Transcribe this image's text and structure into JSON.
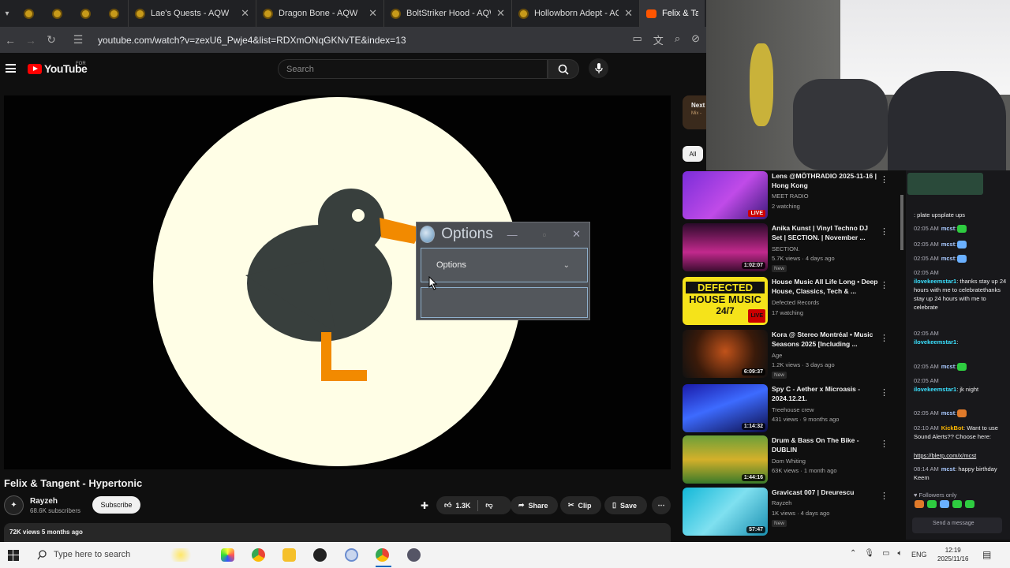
{
  "browser": {
    "tabs": [
      {
        "title": "Lae's Quests - AQW"
      },
      {
        "title": "Dragon Bone - AQW"
      },
      {
        "title": "BoltStriker Hood - AQW"
      },
      {
        "title": "Hollowborn Adept - AQW"
      },
      {
        "title": "Felix & Tange"
      }
    ],
    "url": "youtube.com/watch?v=zexU6_Pwje4&list=RDXmONqGKNvTE&index=13"
  },
  "youtube": {
    "logo_text": "YouTube",
    "logo_sup": "FOR",
    "search_placeholder": "Search",
    "video_title": "Felix & Tangent - Hypertonic",
    "channel_name": "Rayzeh",
    "subscribers": "68.6K subscribers",
    "subscribe_label": "Subscribe",
    "likes": "1.3K",
    "share_label": "Share",
    "clip_label": "Clip",
    "save_label": "Save",
    "desc_meta": "72K views  5 months ago",
    "next_label": "Next",
    "next_sub": "Mix -",
    "chip_all": "All"
  },
  "options_window": {
    "title": "Options",
    "select_value": "Options"
  },
  "recommendations": [
    {
      "title": "Lens @MÖTHRADIO 2025-11-16 | Hong Kong",
      "channel": "MEET RADIO",
      "meta": "2 watching",
      "badge": "LIVE",
      "new": ""
    },
    {
      "title": "Anika Kunst | Vinyl Techno DJ Set | SECTION. | November ...",
      "channel": "SECTION.",
      "meta": "5.7K views · 4 days ago",
      "badge": "1:02:07",
      "new": "New"
    },
    {
      "title": "House Music All Life Long • Deep House, Classics, Tech & ...",
      "channel": "Defected Records",
      "meta": "17 watching",
      "badge": "LIVE",
      "new": ""
    },
    {
      "title": "Kora @ Stereo Montréal • Music Seasons 2025 [Including ...",
      "channel": "Age",
      "meta": "1.2K views · 3 days ago",
      "badge": "6:09:37",
      "new": "New"
    },
    {
      "title": "Spy C - Aether x Microasis - 2024.12.21.",
      "channel": "Treehouse crew",
      "meta": "431 views · 9 months ago",
      "badge": "1:14:32",
      "new": ""
    },
    {
      "title": "Drum & Bass On The Bike - DUBLIN",
      "channel": "Dom Whiting",
      "meta": "63K views · 1 month ago",
      "badge": "1:44:16",
      "new": ""
    },
    {
      "title": "Gravicast 007 | Dreurescu",
      "channel": "Rayzeh",
      "meta": "1K views · 4 days ago",
      "badge": "57:47",
      "new": "New"
    }
  ],
  "chat": {
    "messages": [
      {
        "time": "",
        "name": "",
        "text": ": plate upsplate ups"
      },
      {
        "time": "02:05 AM",
        "name": "mcst",
        "text": ":"
      },
      {
        "time": "02:05 AM",
        "name": "mcst",
        "text": ":"
      },
      {
        "time": "02:05 AM",
        "name": "mcst",
        "text": ":"
      },
      {
        "time": "02:05 AM",
        "name": "ilovekeemstar1",
        "text": ": thanks stay up 24 hours with me to celebratethanks stay up 24 hours with me to celebrate"
      },
      {
        "time": "02:05 AM",
        "name": "ilovekeemstar1",
        "text": ":"
      },
      {
        "time": "02:05 AM",
        "name": "mcst",
        "text": ":"
      },
      {
        "time": "02:05 AM",
        "name": "ilovekeemstar1",
        "text": ": jk night"
      },
      {
        "time": "02:05 AM",
        "name": "mcst",
        "text": ":"
      },
      {
        "time": "02:10 AM",
        "name": "KickBot",
        "text": ": Want to use Sound Alerts?? Choose here:"
      },
      {
        "time": "",
        "name": "",
        "text": "https://blerp.com/x/mcst"
      },
      {
        "time": "08:14 AM",
        "name": "mcst",
        "text": ": happy birthday Keem"
      }
    ],
    "followers_only": "Followers only",
    "send_placeholder": "Send a message"
  },
  "taskbar": {
    "search_placeholder": "Type here to search",
    "lang": "ENG",
    "time": "12:19",
    "date": "2025/11/16"
  }
}
